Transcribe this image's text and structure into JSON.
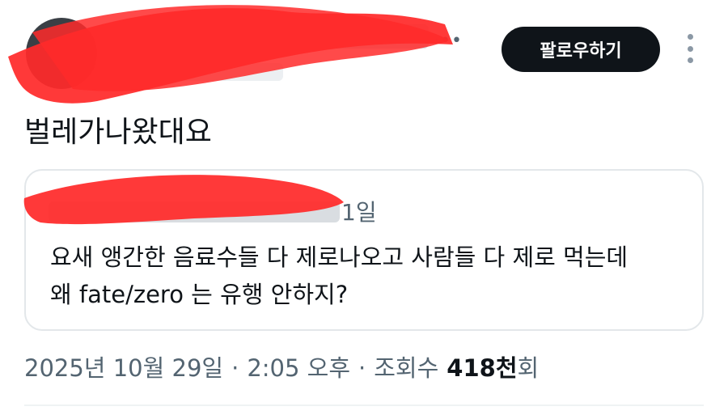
{
  "header": {
    "follow_label": "팔로우하기"
  },
  "tweet": {
    "text": "벌레가나왔대요"
  },
  "quote": {
    "date": "1일",
    "line1": "요새 앵간한 음료수들 다 제로나오고 사람들 다 제로 먹는데",
    "line2": "왜 fate/zero 는 유행 안하지?"
  },
  "meta": {
    "date": "2025년 10월 29일",
    "separator": "·",
    "time": "2:05 오후",
    "views_label": "조회수",
    "views_number": "418천",
    "views_unit": "회"
  },
  "colors": {
    "redaction": "#ff2a2a",
    "follow_bg": "#0f1419",
    "muted_text": "#536471"
  },
  "icons": {
    "kebab": "more-vertical-icon"
  }
}
